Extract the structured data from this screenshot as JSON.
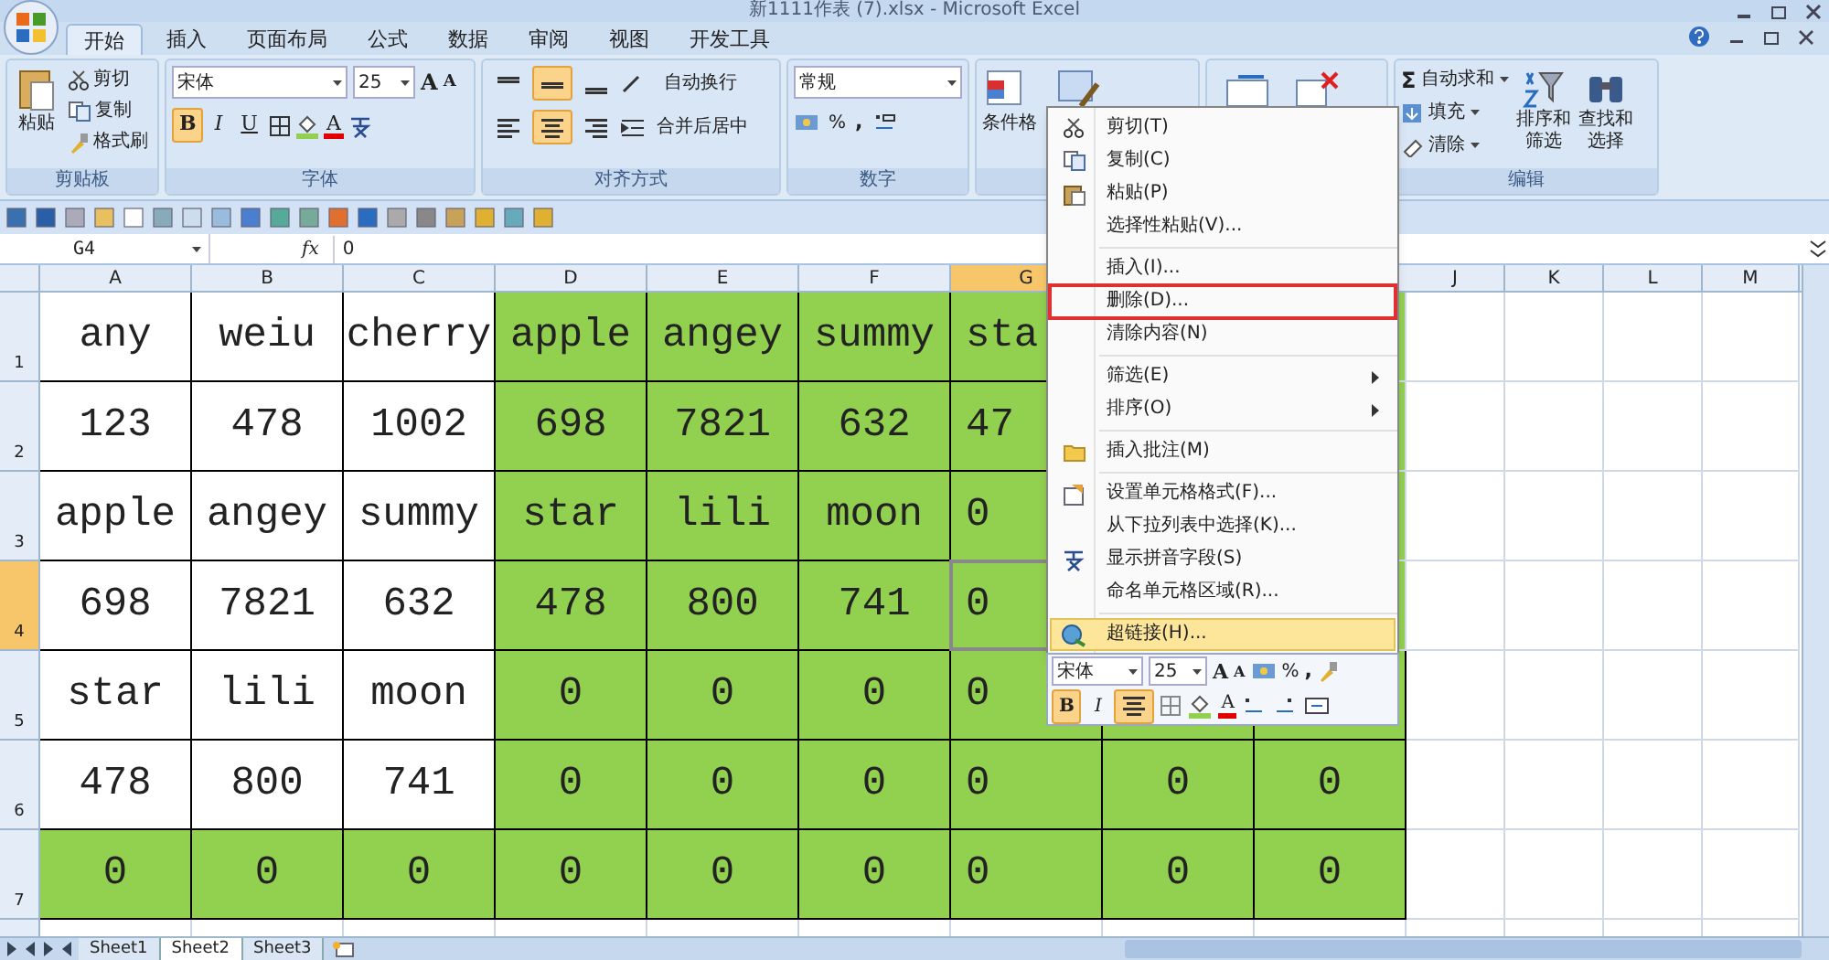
{
  "window": {
    "title": "新1111作表 (7).xlsx - Microsoft Excel"
  },
  "ribbon_tabs": [
    {
      "label": "开始",
      "selected": true
    },
    {
      "label": "插入",
      "selected": false
    },
    {
      "label": "页面布局",
      "selected": false
    },
    {
      "label": "公式",
      "selected": false
    },
    {
      "label": "数据",
      "selected": false
    },
    {
      "label": "审阅",
      "selected": false
    },
    {
      "label": "视图",
      "selected": false
    },
    {
      "label": "开发工具",
      "selected": false
    }
  ],
  "clipboard": {
    "paste": "粘贴",
    "cut": "剪切",
    "copy": "复制",
    "format_painter": "格式刷",
    "label": "剪贴板"
  },
  "font": {
    "name": "宋体",
    "size": "25",
    "grow": "A",
    "shrink": "A",
    "bold": {
      "text": "B",
      "selected": true
    },
    "italic": {
      "text": "I",
      "selected": false
    },
    "underline": {
      "text": "U",
      "selected": false
    },
    "font_color": "A",
    "label": "字体"
  },
  "alignment": {
    "vertical": [
      {
        "kind": "top",
        "selected": false
      },
      {
        "kind": "middle",
        "selected": true
      },
      {
        "kind": "bottom",
        "selected": false
      }
    ],
    "horizontal": [
      {
        "kind": "left",
        "selected": false
      },
      {
        "kind": "center",
        "selected": true
      },
      {
        "kind": "right",
        "selected": false
      }
    ],
    "wrap": "自动换行",
    "merge": "合并后居中",
    "label": "对齐方式"
  },
  "number": {
    "format": "常规",
    "percent": "%",
    "comma": ",",
    "label": "数字"
  },
  "styles": {
    "conditional": "条件格"
  },
  "editing": {
    "autosum_symbol": "Σ",
    "autosum": "自动求和",
    "fill": "填充",
    "clear": "清除",
    "sort": [
      "排序和",
      "筛选"
    ],
    "find": [
      "查找和",
      "选择"
    ],
    "label": "编辑"
  },
  "formula_bar": {
    "name_box": "G4",
    "function_label": "fx",
    "formula": "0"
  },
  "columns": [
    {
      "label": "A",
      "selected": false
    },
    {
      "label": "B",
      "selected": false
    },
    {
      "label": "C",
      "selected": false
    },
    {
      "label": "D",
      "selected": false
    },
    {
      "label": "E",
      "selected": false
    },
    {
      "label": "F",
      "selected": false
    },
    {
      "label": "G",
      "selected": true
    }
  ],
  "columns_after_menu": [
    {
      "label": "J",
      "selected": false
    },
    {
      "label": "K",
      "selected": false
    },
    {
      "label": "L",
      "selected": false
    },
    {
      "label": "M",
      "selected": false
    }
  ],
  "rows": [
    {
      "label": "1",
      "selected": false,
      "cells": [
        {
          "text": "any",
          "color": "#ffffff"
        },
        {
          "text": "weiu",
          "color": "#ffffff"
        },
        {
          "text": "cherry",
          "color": "#ffffff"
        },
        {
          "text": "apple",
          "color": "#92d050"
        },
        {
          "text": "angey",
          "color": "#92d050"
        },
        {
          "text": "summy",
          "color": "#92d050"
        },
        {
          "text": "sta",
          "color": "#92d050"
        }
      ]
    },
    {
      "label": "2",
      "selected": false,
      "cells": [
        {
          "text": "123",
          "color": "#ffffff"
        },
        {
          "text": "478",
          "color": "#ffffff"
        },
        {
          "text": "1002",
          "color": "#ffffff"
        },
        {
          "text": "698",
          "color": "#92d050"
        },
        {
          "text": "7821",
          "color": "#92d050"
        },
        {
          "text": "632",
          "color": "#92d050"
        },
        {
          "text": "47",
          "color": "#92d050"
        }
      ]
    },
    {
      "label": "3",
      "selected": false,
      "cells": [
        {
          "text": "apple",
          "color": "#ffffff"
        },
        {
          "text": "angey",
          "color": "#ffffff"
        },
        {
          "text": "summy",
          "color": "#ffffff"
        },
        {
          "text": "star",
          "color": "#92d050"
        },
        {
          "text": "lili",
          "color": "#92d050"
        },
        {
          "text": "moon",
          "color": "#92d050"
        },
        {
          "text": "0",
          "color": "#92d050"
        }
      ]
    },
    {
      "label": "4",
      "selected": true,
      "cells": [
        {
          "text": "698",
          "color": "#ffffff"
        },
        {
          "text": "7821",
          "color": "#ffffff"
        },
        {
          "text": "632",
          "color": "#ffffff"
        },
        {
          "text": "478",
          "color": "#92d050"
        },
        {
          "text": "800",
          "color": "#92d050"
        },
        {
          "text": "741",
          "color": "#92d050"
        },
        {
          "text": "0",
          "color": "#92d050"
        }
      ]
    },
    {
      "label": "5",
      "selected": false,
      "cells": [
        {
          "text": "star",
          "color": "#ffffff"
        },
        {
          "text": "lili",
          "color": "#ffffff"
        },
        {
          "text": "moon",
          "color": "#ffffff"
        },
        {
          "text": "0",
          "color": "#92d050"
        },
        {
          "text": "0",
          "color": "#92d050"
        },
        {
          "text": "0",
          "color": "#92d050"
        },
        {
          "text": "0",
          "color": "#92d050"
        },
        {
          "color": "#92d050"
        },
        {
          "color": "#92d050"
        }
      ]
    },
    {
      "label": "6",
      "selected": false,
      "cells": [
        {
          "text": "478",
          "color": "#ffffff"
        },
        {
          "text": "800",
          "color": "#ffffff"
        },
        {
          "text": "741",
          "color": "#ffffff"
        },
        {
          "text": "0",
          "color": "#92d050"
        },
        {
          "text": "0",
          "color": "#92d050"
        },
        {
          "text": "0",
          "color": "#92d050"
        },
        {
          "text": "0",
          "color": "#92d050"
        },
        {
          "text": "0",
          "color": "#92d050"
        },
        {
          "text": "0",
          "color": "#92d050"
        }
      ]
    },
    {
      "label": "7",
      "selected": false,
      "cells": [
        {
          "text": "0",
          "color": "#92d050"
        },
        {
          "text": "0",
          "color": "#92d050"
        },
        {
          "text": "0",
          "color": "#92d050"
        },
        {
          "text": "0",
          "color": "#92d050"
        },
        {
          "text": "0",
          "color": "#92d050"
        },
        {
          "text": "0",
          "color": "#92d050"
        },
        {
          "text": "0",
          "color": "#92d050"
        },
        {
          "text": "0",
          "color": "#92d050"
        },
        {
          "text": "0",
          "color": "#92d050"
        }
      ]
    }
  ],
  "sheets": [
    {
      "label": "Sheet1",
      "selected": false
    },
    {
      "label": "Sheet2",
      "selected": true
    },
    {
      "label": "Sheet3",
      "selected": false
    }
  ],
  "context_menu": {
    "items": [
      {
        "kind": "cut",
        "label": "剪切(T)"
      },
      {
        "kind": "copy",
        "label": "复制(C)"
      },
      {
        "kind": "paste",
        "label": "粘贴(P)"
      },
      {
        "kind": "plain",
        "label": "选择性粘贴(V)..."
      },
      {
        "kind": "separator"
      },
      {
        "kind": "plain",
        "label": "插入(I)..."
      },
      {
        "kind": "plain",
        "label": "删除(D)...",
        "marked": true
      },
      {
        "kind": "plain",
        "label": "清除内容(N)"
      },
      {
        "kind": "separator"
      },
      {
        "kind": "submenu",
        "label": "筛选(E)"
      },
      {
        "kind": "submenu",
        "label": "排序(O)"
      },
      {
        "kind": "separator"
      },
      {
        "kind": "comment",
        "label": "插入批注(M)"
      },
      {
        "kind": "separator"
      },
      {
        "kind": "format",
        "label": "设置单元格格式(F)..."
      },
      {
        "kind": "plain",
        "label": "从下拉列表中选择(K)..."
      },
      {
        "kind": "phonetic",
        "label": "显示拼音字段(S)"
      },
      {
        "kind": "plain",
        "label": "命名单元格区域(R)..."
      },
      {
        "kind": "separator"
      },
      {
        "kind": "link",
        "label": "超链接(H)...",
        "highlighted": true
      }
    ]
  },
  "mini_toolbar": {
    "font": "宋体",
    "size": "25",
    "grow": "A",
    "shrink": "A",
    "percent": "%",
    "comma": ",",
    "bold": {
      "text": "B",
      "selected": true
    },
    "italic": {
      "text": "I",
      "selected": false
    },
    "center": {
      "selected": true
    },
    "font_color": "A"
  }
}
